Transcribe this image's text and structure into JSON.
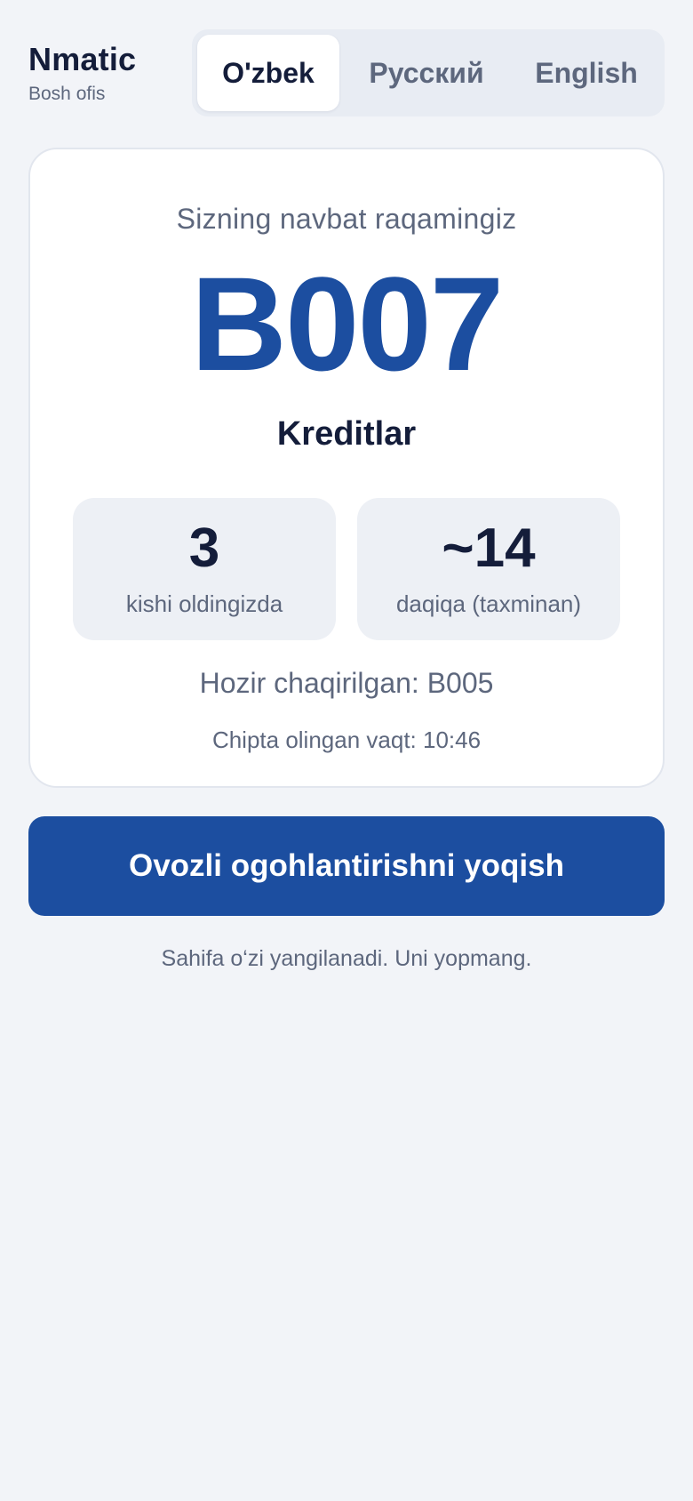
{
  "brand": {
    "name": "Nmatic",
    "subtitle": "Bosh ofis"
  },
  "languages": {
    "active": "uz",
    "items": [
      {
        "code": "uz",
        "label": "O'zbek"
      },
      {
        "code": "ru",
        "label": "Русский"
      },
      {
        "code": "en",
        "label": "English"
      }
    ]
  },
  "ticket": {
    "label": "Sizning navbat raqamingiz",
    "number": "B007",
    "service": "Kreditlar",
    "people_ahead": {
      "value": "3",
      "caption": "kishi oldingizda"
    },
    "wait_time": {
      "value": "~14",
      "caption": "daqiqa (taxminan)"
    },
    "now_called": "Hozir chaqirilgan: B005",
    "issued_time": "Chipta olingan vaqt: 10:46"
  },
  "actions": {
    "sound_label": "Ovozli ogohlantirishni yoqish"
  },
  "footer": {
    "note": "Sahifa o‘zi yangilanadi. Uni yopmang."
  },
  "colors": {
    "accent": "#1c4ea0",
    "background": "#f2f4f8",
    "text_dark": "#141d3a",
    "text_muted": "#5d677d"
  }
}
